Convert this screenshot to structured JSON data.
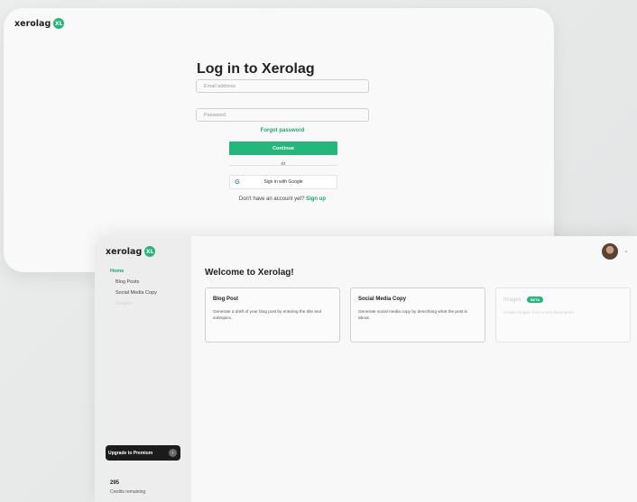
{
  "brand": {
    "name": "xerolag",
    "badge": "XL"
  },
  "login": {
    "title": "Log in to Xerolag",
    "email_placeholder": "Email address",
    "password_placeholder": "Password",
    "forgot": "Forgot password",
    "continue": "Continue",
    "or": "or",
    "google": "Sign in with Google",
    "google_glyph": "G",
    "no_account": "Don't have an account yet?",
    "signup": "Sign up"
  },
  "sidebar": {
    "home": "Home",
    "items": [
      "Blog Posts",
      "Social Media Copy",
      "Images"
    ],
    "upgrade": "Upgrade to Premium",
    "credits_count": "295",
    "credits_label": "Credits remaining"
  },
  "main": {
    "welcome": "Welcome to Xerolag!",
    "cards": [
      {
        "title": "Blog Post",
        "desc": "Generate a draft of your blog post by entering the title and subtopics."
      },
      {
        "title": "Social Media Copy",
        "desc": "Generate social media copy by describing what the post is about."
      },
      {
        "title": "Images",
        "badge": "BETA",
        "desc": "Create images from a text description."
      }
    ]
  },
  "colors": {
    "accent": "#25b67c",
    "dark": "#1c1c1c"
  }
}
